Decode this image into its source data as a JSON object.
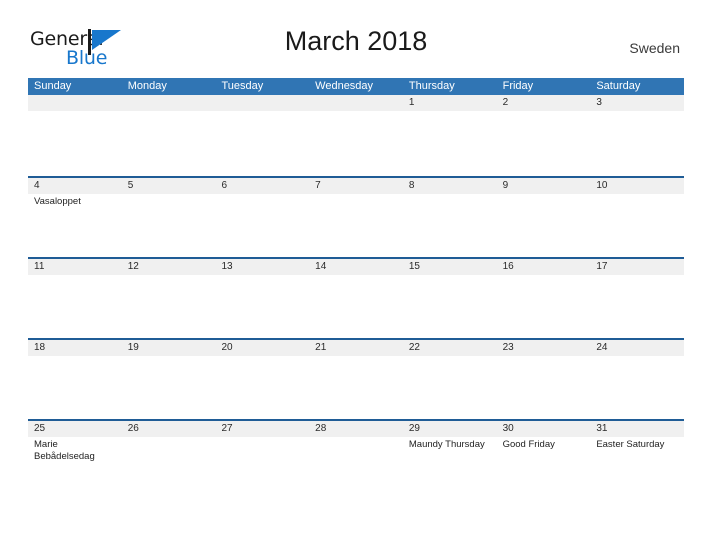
{
  "brand": {
    "name_part1": "General",
    "name_part2": "Blue",
    "flag_icon": "blue-flag-icon",
    "accent_color": "#1877cc"
  },
  "header": {
    "title": "March 2018",
    "country": "Sweden"
  },
  "colors": {
    "weekday_header_bg": "#3075b4",
    "week_divider": "#1f5c96",
    "daynum_band_bg": "#f0f0f0",
    "page_bg": "#ffffff",
    "text": "#1f1f1f"
  },
  "calendar": {
    "weekdays": [
      "Sunday",
      "Monday",
      "Tuesday",
      "Wednesday",
      "Thursday",
      "Friday",
      "Saturday"
    ],
    "weeks": [
      {
        "days": [
          {
            "num": "",
            "events": []
          },
          {
            "num": "",
            "events": []
          },
          {
            "num": "",
            "events": []
          },
          {
            "num": "",
            "events": []
          },
          {
            "num": "1",
            "events": []
          },
          {
            "num": "2",
            "events": []
          },
          {
            "num": "3",
            "events": []
          }
        ]
      },
      {
        "days": [
          {
            "num": "4",
            "events": [
              "Vasaloppet"
            ]
          },
          {
            "num": "5",
            "events": []
          },
          {
            "num": "6",
            "events": []
          },
          {
            "num": "7",
            "events": []
          },
          {
            "num": "8",
            "events": []
          },
          {
            "num": "9",
            "events": []
          },
          {
            "num": "10",
            "events": []
          }
        ]
      },
      {
        "days": [
          {
            "num": "11",
            "events": []
          },
          {
            "num": "12",
            "events": []
          },
          {
            "num": "13",
            "events": []
          },
          {
            "num": "14",
            "events": []
          },
          {
            "num": "15",
            "events": []
          },
          {
            "num": "16",
            "events": []
          },
          {
            "num": "17",
            "events": []
          }
        ]
      },
      {
        "days": [
          {
            "num": "18",
            "events": []
          },
          {
            "num": "19",
            "events": []
          },
          {
            "num": "20",
            "events": []
          },
          {
            "num": "21",
            "events": []
          },
          {
            "num": "22",
            "events": []
          },
          {
            "num": "23",
            "events": []
          },
          {
            "num": "24",
            "events": []
          }
        ]
      },
      {
        "days": [
          {
            "num": "25",
            "events": [
              "Marie Bebådelsedag"
            ]
          },
          {
            "num": "26",
            "events": []
          },
          {
            "num": "27",
            "events": []
          },
          {
            "num": "28",
            "events": []
          },
          {
            "num": "29",
            "events": [
              "Maundy Thursday"
            ]
          },
          {
            "num": "30",
            "events": [
              "Good Friday"
            ]
          },
          {
            "num": "31",
            "events": [
              "Easter Saturday"
            ]
          }
        ]
      }
    ]
  }
}
